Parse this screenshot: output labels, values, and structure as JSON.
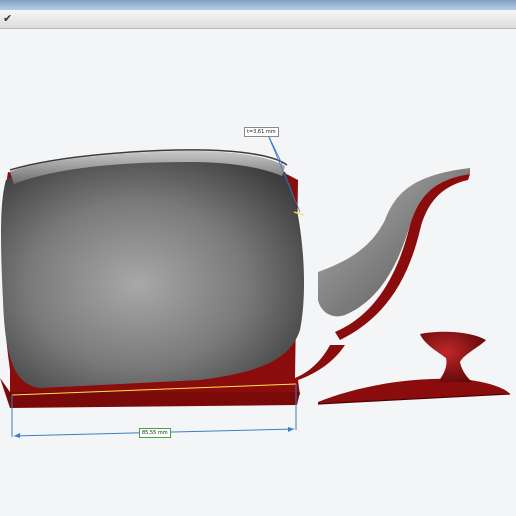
{
  "window": {
    "title": ""
  },
  "toolbar": {
    "confirm_icon": "checkmark-icon"
  },
  "viewport": {
    "model": "teapot-section",
    "measurements": {
      "wall_thickness": "t=3,61 mm",
      "base_width": "85,55 mm"
    },
    "colors": {
      "background": "#f4f5f6",
      "surface": "#8c8c8c",
      "section": "#8a0c0c",
      "dimension_line": "#3a7fc0",
      "selected_label_border": "#3caa3c"
    }
  }
}
